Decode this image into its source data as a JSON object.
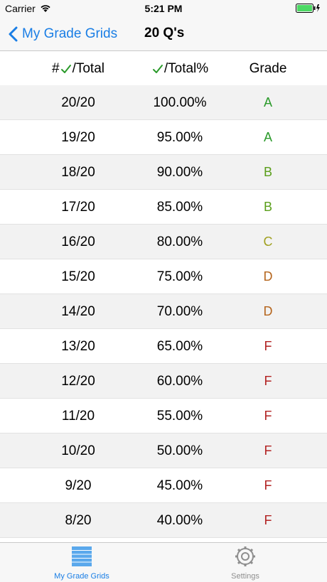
{
  "status": {
    "carrier": "Carrier",
    "time": "5:21 PM"
  },
  "nav": {
    "back_label": "My Grade Grids",
    "title": "20 Q's"
  },
  "table": {
    "headers": {
      "col1_prefix": "#",
      "col1_suffix": "/Total",
      "col2_suffix": "/Total%",
      "col3": "Grade"
    },
    "rows": [
      {
        "score": "20/20",
        "percent": "100.00%",
        "grade": "A",
        "color": "#2a9a2a"
      },
      {
        "score": "19/20",
        "percent": "95.00%",
        "grade": "A",
        "color": "#2a9a2a"
      },
      {
        "score": "18/20",
        "percent": "90.00%",
        "grade": "B",
        "color": "#5a9e1a"
      },
      {
        "score": "17/20",
        "percent": "85.00%",
        "grade": "B",
        "color": "#5a9e1a"
      },
      {
        "score": "16/20",
        "percent": "80.00%",
        "grade": "C",
        "color": "#a0a020"
      },
      {
        "score": "15/20",
        "percent": "75.00%",
        "grade": "D",
        "color": "#b5651d"
      },
      {
        "score": "14/20",
        "percent": "70.00%",
        "grade": "D",
        "color": "#b5651d"
      },
      {
        "score": "13/20",
        "percent": "65.00%",
        "grade": "F",
        "color": "#b22222"
      },
      {
        "score": "12/20",
        "percent": "60.00%",
        "grade": "F",
        "color": "#b22222"
      },
      {
        "score": "11/20",
        "percent": "55.00%",
        "grade": "F",
        "color": "#b22222"
      },
      {
        "score": "10/20",
        "percent": "50.00%",
        "grade": "F",
        "color": "#b22222"
      },
      {
        "score": "9/20",
        "percent": "45.00%",
        "grade": "F",
        "color": "#b22222"
      },
      {
        "score": "8/20",
        "percent": "40.00%",
        "grade": "F",
        "color": "#b22222"
      }
    ]
  },
  "tabs": [
    {
      "label": "My Grade Grids",
      "icon": "grid-icon",
      "active": true
    },
    {
      "label": "Settings",
      "icon": "gear-icon",
      "active": false
    }
  ],
  "colors": {
    "accent": "#1a7ee5",
    "check": "#2a9a2a",
    "battery": "#4cd964"
  }
}
